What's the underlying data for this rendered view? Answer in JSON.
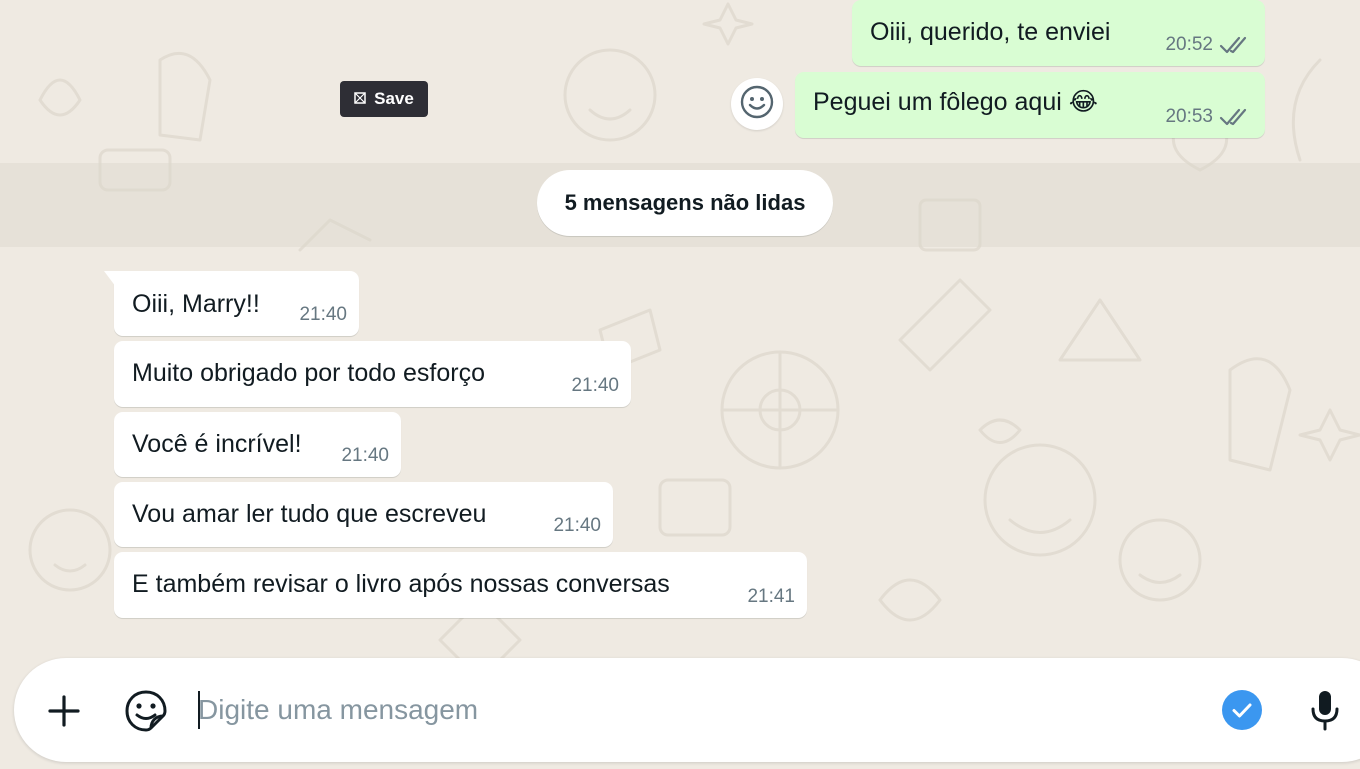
{
  "toolbar": {
    "save_label": "Save"
  },
  "divider": {
    "unread_label": "5 mensagens não lidas"
  },
  "messages_out": [
    {
      "text": "Oiii, querido, te enviei",
      "time": "20:52",
      "status": "read-double-check-icon"
    },
    {
      "text": "Peguei um fôlego aqui 😂",
      "time": "20:53",
      "status": "read-double-check-icon"
    }
  ],
  "messages_in": [
    {
      "text": "Oiii, Marry!!",
      "time": "21:40"
    },
    {
      "text": "Muito obrigado por todo esforço",
      "time": "21:40"
    },
    {
      "text": "Você é incrível!",
      "time": "21:40"
    },
    {
      "text": "Vou amar ler tudo que escreveu",
      "time": "21:40"
    },
    {
      "text": "E também revisar o livro após nossas conversas",
      "time": "21:41"
    }
  ],
  "composer": {
    "placeholder": "Digite uma mensagem",
    "icons": [
      "plus-icon",
      "sticker-icon",
      "check-circle-icon",
      "microphone-icon"
    ]
  },
  "colors": {
    "background": "#efeae2",
    "outgoing_bubble": "#d9fdd3",
    "incoming_bubble": "#ffffff",
    "timestamp": "#667781",
    "check_blue": "#53bdeb",
    "composer_check": "#3b97f0"
  }
}
